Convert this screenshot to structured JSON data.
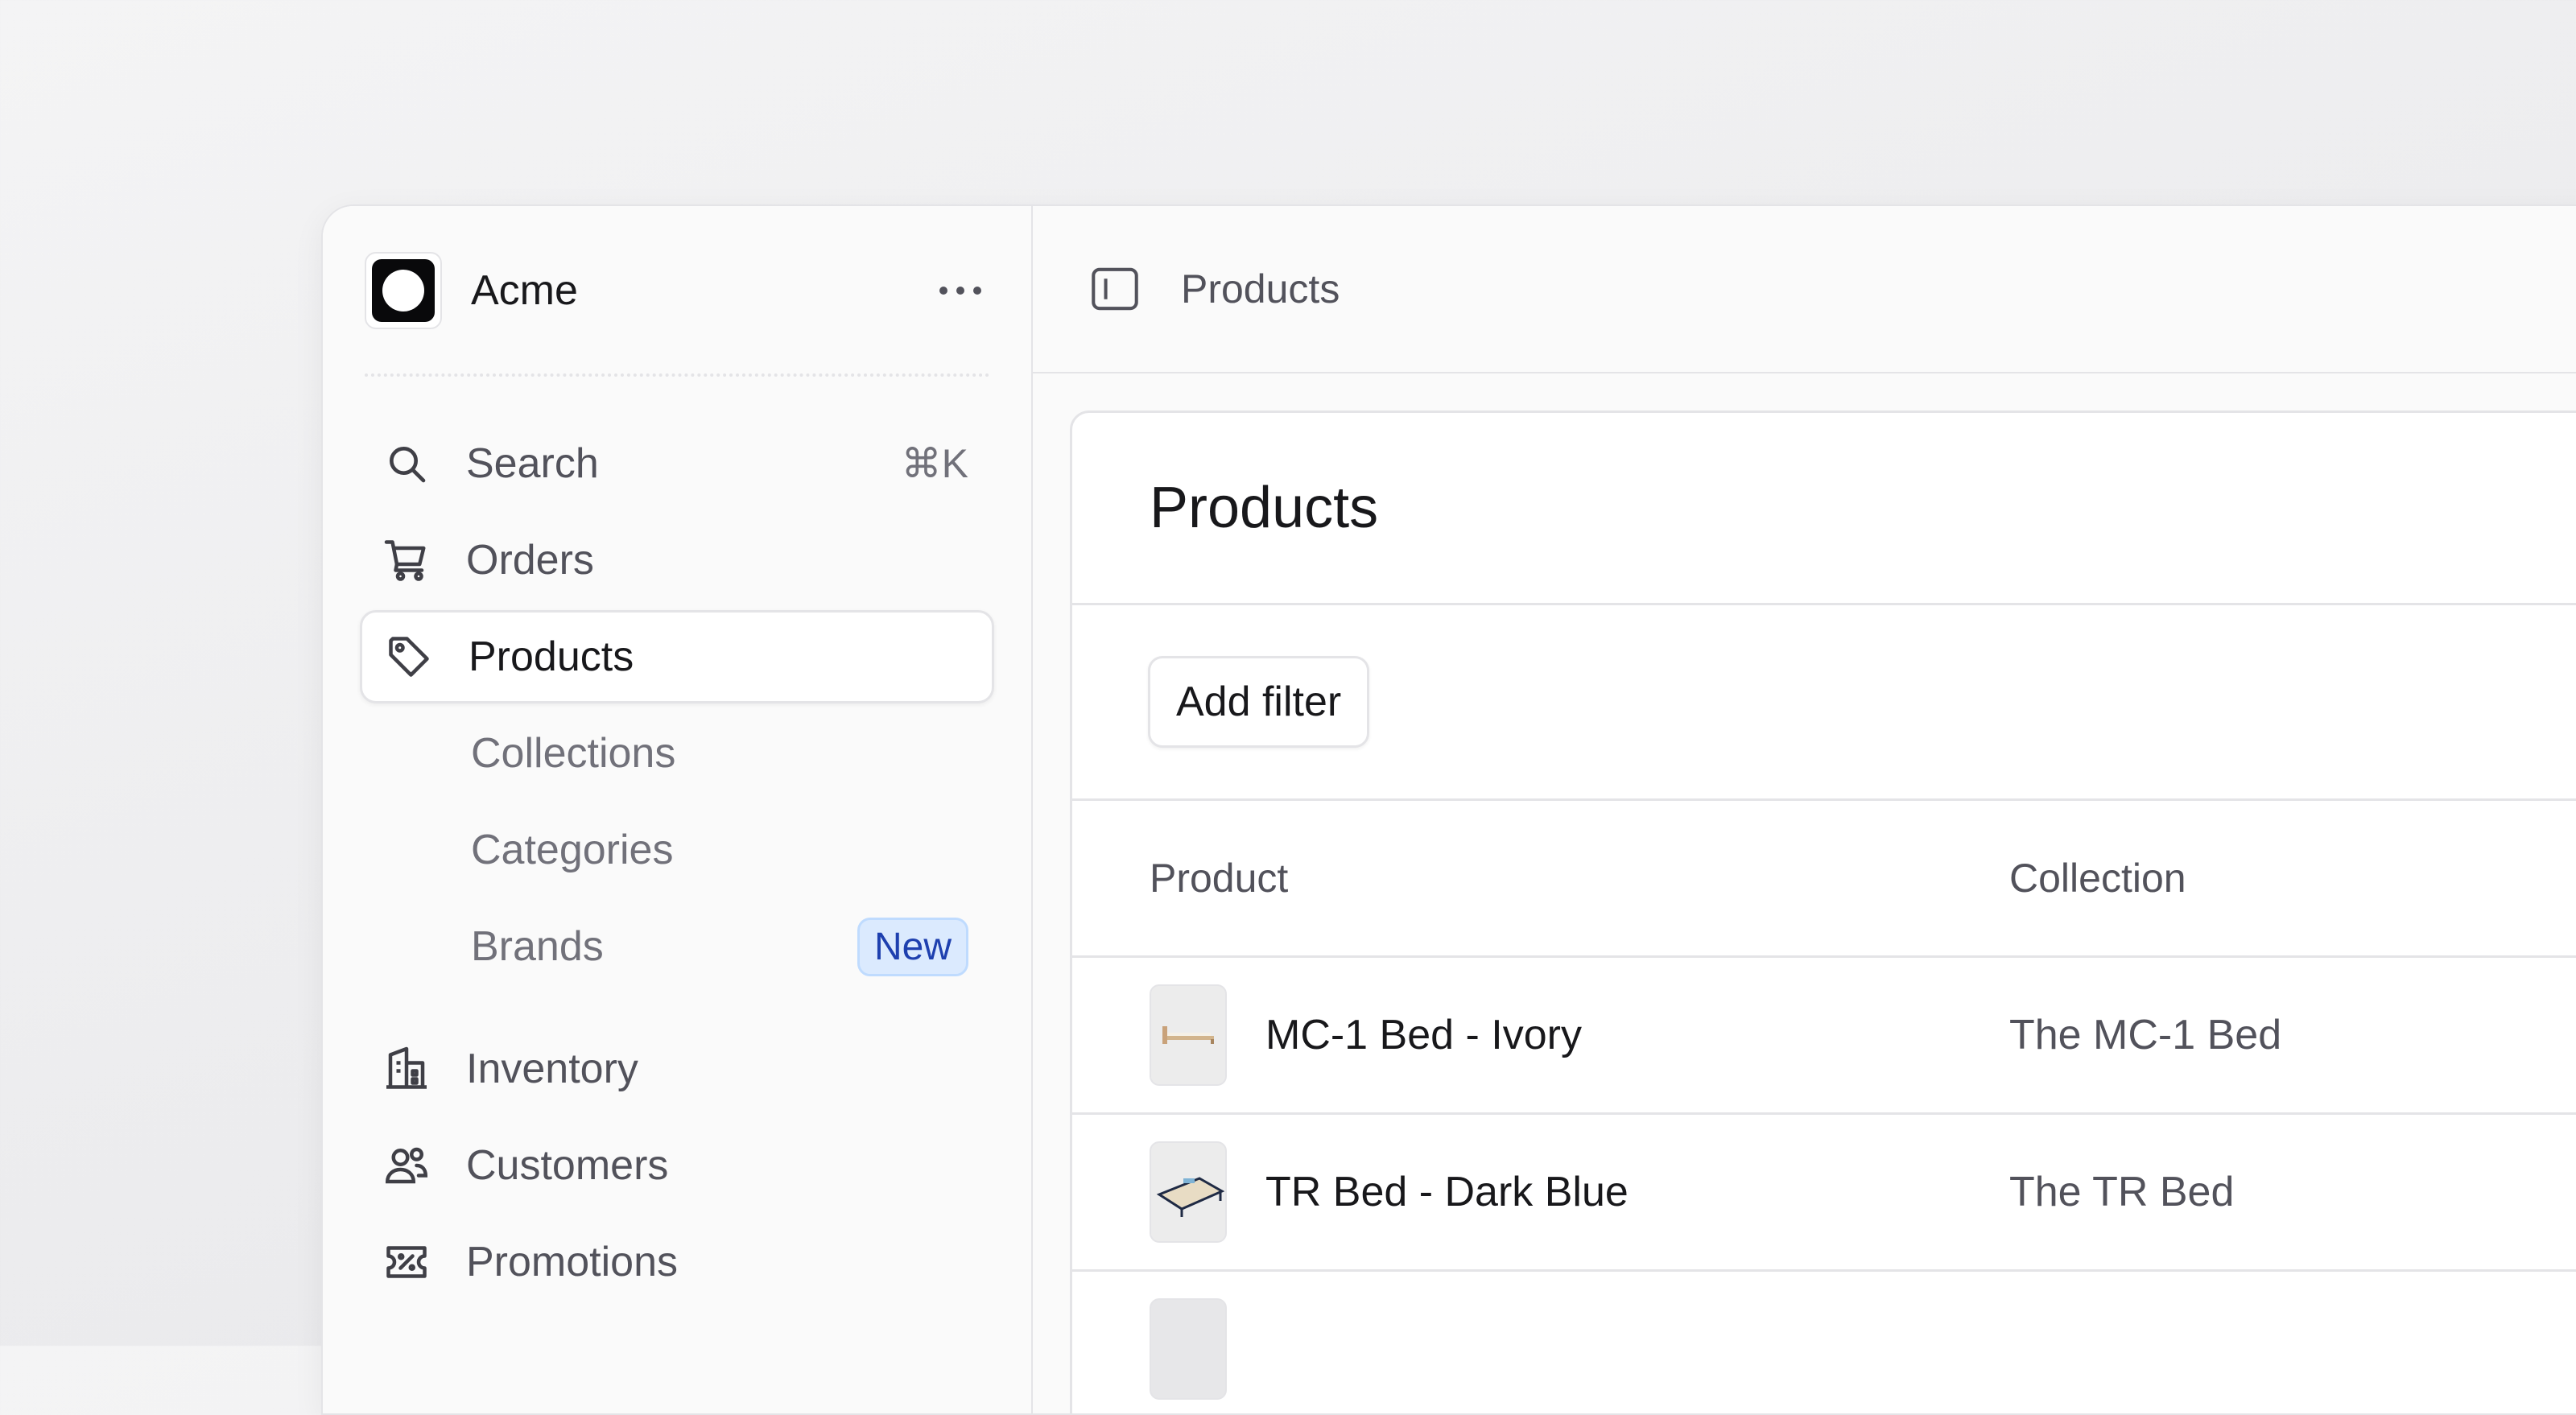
{
  "app": {
    "name": "Acme"
  },
  "sidebar": {
    "search": {
      "label": "Search",
      "shortcut": "⌘K"
    },
    "items": [
      {
        "label": "Orders",
        "icon": "cart-icon"
      },
      {
        "label": "Products",
        "icon": "tag-icon",
        "active": true
      },
      {
        "label": "Collections",
        "sub": true
      },
      {
        "label": "Categories",
        "sub": true
      },
      {
        "label": "Brands",
        "sub": true,
        "badge": "New"
      },
      {
        "label": "Inventory",
        "icon": "building-icon"
      },
      {
        "label": "Customers",
        "icon": "users-icon"
      },
      {
        "label": "Promotions",
        "icon": "discount-ticket-icon"
      }
    ]
  },
  "topbar": {
    "breadcrumb": "Products"
  },
  "page": {
    "title": "Products",
    "add_filter_label": "Add filter",
    "table": {
      "columns": [
        "Product",
        "Collection"
      ],
      "rows": [
        {
          "product": "MC-1 Bed - Ivory",
          "collection": "The MC-1 Bed"
        },
        {
          "product": "TR Bed - Dark Blue",
          "collection": "The TR Bed"
        }
      ]
    }
  },
  "colors": {
    "badge_bg": "#dbeafe",
    "badge_text": "#1e40af",
    "text": "#18181b",
    "muted": "#52525b"
  }
}
